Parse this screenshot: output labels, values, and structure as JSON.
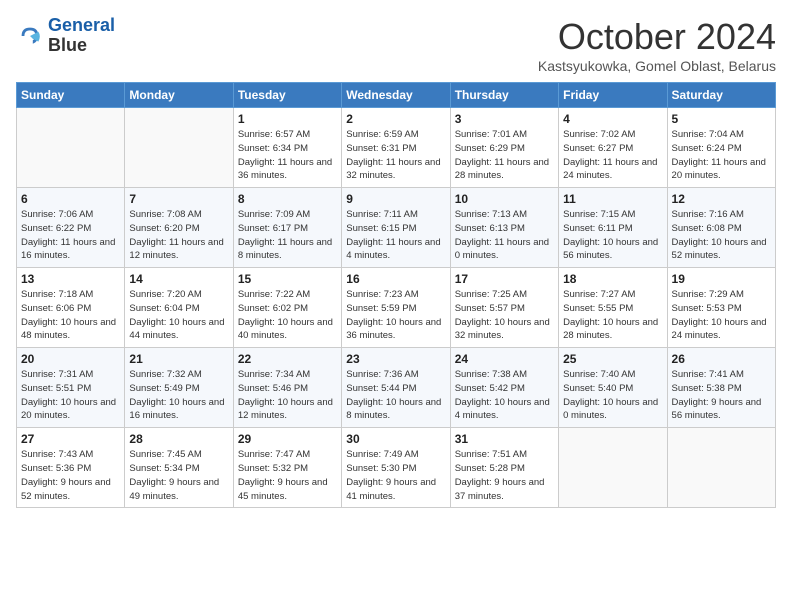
{
  "header": {
    "logo_line1": "General",
    "logo_line2": "Blue",
    "month": "October 2024",
    "location": "Kastsyukowka, Gomel Oblast, Belarus"
  },
  "days_of_week": [
    "Sunday",
    "Monday",
    "Tuesday",
    "Wednesday",
    "Thursday",
    "Friday",
    "Saturday"
  ],
  "weeks": [
    [
      {
        "day": null
      },
      {
        "day": null
      },
      {
        "day": "1",
        "sunrise": "Sunrise: 6:57 AM",
        "sunset": "Sunset: 6:34 PM",
        "daylight": "Daylight: 11 hours and 36 minutes."
      },
      {
        "day": "2",
        "sunrise": "Sunrise: 6:59 AM",
        "sunset": "Sunset: 6:31 PM",
        "daylight": "Daylight: 11 hours and 32 minutes."
      },
      {
        "day": "3",
        "sunrise": "Sunrise: 7:01 AM",
        "sunset": "Sunset: 6:29 PM",
        "daylight": "Daylight: 11 hours and 28 minutes."
      },
      {
        "day": "4",
        "sunrise": "Sunrise: 7:02 AM",
        "sunset": "Sunset: 6:27 PM",
        "daylight": "Daylight: 11 hours and 24 minutes."
      },
      {
        "day": "5",
        "sunrise": "Sunrise: 7:04 AM",
        "sunset": "Sunset: 6:24 PM",
        "daylight": "Daylight: 11 hours and 20 minutes."
      }
    ],
    [
      {
        "day": "6",
        "sunrise": "Sunrise: 7:06 AM",
        "sunset": "Sunset: 6:22 PM",
        "daylight": "Daylight: 11 hours and 16 minutes."
      },
      {
        "day": "7",
        "sunrise": "Sunrise: 7:08 AM",
        "sunset": "Sunset: 6:20 PM",
        "daylight": "Daylight: 11 hours and 12 minutes."
      },
      {
        "day": "8",
        "sunrise": "Sunrise: 7:09 AM",
        "sunset": "Sunset: 6:17 PM",
        "daylight": "Daylight: 11 hours and 8 minutes."
      },
      {
        "day": "9",
        "sunrise": "Sunrise: 7:11 AM",
        "sunset": "Sunset: 6:15 PM",
        "daylight": "Daylight: 11 hours and 4 minutes."
      },
      {
        "day": "10",
        "sunrise": "Sunrise: 7:13 AM",
        "sunset": "Sunset: 6:13 PM",
        "daylight": "Daylight: 11 hours and 0 minutes."
      },
      {
        "day": "11",
        "sunrise": "Sunrise: 7:15 AM",
        "sunset": "Sunset: 6:11 PM",
        "daylight": "Daylight: 10 hours and 56 minutes."
      },
      {
        "day": "12",
        "sunrise": "Sunrise: 7:16 AM",
        "sunset": "Sunset: 6:08 PM",
        "daylight": "Daylight: 10 hours and 52 minutes."
      }
    ],
    [
      {
        "day": "13",
        "sunrise": "Sunrise: 7:18 AM",
        "sunset": "Sunset: 6:06 PM",
        "daylight": "Daylight: 10 hours and 48 minutes."
      },
      {
        "day": "14",
        "sunrise": "Sunrise: 7:20 AM",
        "sunset": "Sunset: 6:04 PM",
        "daylight": "Daylight: 10 hours and 44 minutes."
      },
      {
        "day": "15",
        "sunrise": "Sunrise: 7:22 AM",
        "sunset": "Sunset: 6:02 PM",
        "daylight": "Daylight: 10 hours and 40 minutes."
      },
      {
        "day": "16",
        "sunrise": "Sunrise: 7:23 AM",
        "sunset": "Sunset: 5:59 PM",
        "daylight": "Daylight: 10 hours and 36 minutes."
      },
      {
        "day": "17",
        "sunrise": "Sunrise: 7:25 AM",
        "sunset": "Sunset: 5:57 PM",
        "daylight": "Daylight: 10 hours and 32 minutes."
      },
      {
        "day": "18",
        "sunrise": "Sunrise: 7:27 AM",
        "sunset": "Sunset: 5:55 PM",
        "daylight": "Daylight: 10 hours and 28 minutes."
      },
      {
        "day": "19",
        "sunrise": "Sunrise: 7:29 AM",
        "sunset": "Sunset: 5:53 PM",
        "daylight": "Daylight: 10 hours and 24 minutes."
      }
    ],
    [
      {
        "day": "20",
        "sunrise": "Sunrise: 7:31 AM",
        "sunset": "Sunset: 5:51 PM",
        "daylight": "Daylight: 10 hours and 20 minutes."
      },
      {
        "day": "21",
        "sunrise": "Sunrise: 7:32 AM",
        "sunset": "Sunset: 5:49 PM",
        "daylight": "Daylight: 10 hours and 16 minutes."
      },
      {
        "day": "22",
        "sunrise": "Sunrise: 7:34 AM",
        "sunset": "Sunset: 5:46 PM",
        "daylight": "Daylight: 10 hours and 12 minutes."
      },
      {
        "day": "23",
        "sunrise": "Sunrise: 7:36 AM",
        "sunset": "Sunset: 5:44 PM",
        "daylight": "Daylight: 10 hours and 8 minutes."
      },
      {
        "day": "24",
        "sunrise": "Sunrise: 7:38 AM",
        "sunset": "Sunset: 5:42 PM",
        "daylight": "Daylight: 10 hours and 4 minutes."
      },
      {
        "day": "25",
        "sunrise": "Sunrise: 7:40 AM",
        "sunset": "Sunset: 5:40 PM",
        "daylight": "Daylight: 10 hours and 0 minutes."
      },
      {
        "day": "26",
        "sunrise": "Sunrise: 7:41 AM",
        "sunset": "Sunset: 5:38 PM",
        "daylight": "Daylight: 9 hours and 56 minutes."
      }
    ],
    [
      {
        "day": "27",
        "sunrise": "Sunrise: 7:43 AM",
        "sunset": "Sunset: 5:36 PM",
        "daylight": "Daylight: 9 hours and 52 minutes."
      },
      {
        "day": "28",
        "sunrise": "Sunrise: 7:45 AM",
        "sunset": "Sunset: 5:34 PM",
        "daylight": "Daylight: 9 hours and 49 minutes."
      },
      {
        "day": "29",
        "sunrise": "Sunrise: 7:47 AM",
        "sunset": "Sunset: 5:32 PM",
        "daylight": "Daylight: 9 hours and 45 minutes."
      },
      {
        "day": "30",
        "sunrise": "Sunrise: 7:49 AM",
        "sunset": "Sunset: 5:30 PM",
        "daylight": "Daylight: 9 hours and 41 minutes."
      },
      {
        "day": "31",
        "sunrise": "Sunrise: 7:51 AM",
        "sunset": "Sunset: 5:28 PM",
        "daylight": "Daylight: 9 hours and 37 minutes."
      },
      {
        "day": null
      },
      {
        "day": null
      }
    ]
  ]
}
